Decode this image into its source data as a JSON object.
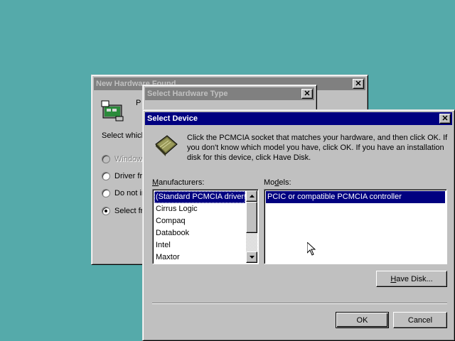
{
  "windows": {
    "new_hardware": {
      "title": "New Hardware Found",
      "device_text_partial": "P",
      "prompt_partial": "Select which",
      "options": [
        {
          "label": "Window",
          "selected": false,
          "disabled": true
        },
        {
          "label": "Driver fro",
          "selected": false,
          "disabled": false
        },
        {
          "label": "Do not in",
          "selected": false,
          "disabled": false
        },
        {
          "label": "Select fro",
          "selected": true,
          "disabled": false
        }
      ],
      "close_symbol": "✕"
    },
    "select_hardware_type": {
      "title": "Select Hardware Type",
      "close_symbol": "✕"
    },
    "select_device": {
      "title": "Select Device",
      "close_symbol": "✕",
      "instructions": "Click the PCMCIA socket that matches your hardware, and then click OK. If you don't know which model you have, click OK. If you have an installation disk for this device, click Have Disk.",
      "manufacturers_label": "Manufacturers:",
      "manufacturers_label_ul": "M",
      "manufacturers_label_rest": "anufacturers:",
      "models_label_pre": "Mo",
      "models_label_ul": "d",
      "models_label_rest": "els:",
      "manufacturers": [
        "(Standard PCMCIA drivers)",
        "Cirrus Logic",
        "Compaq",
        "Databook",
        "Intel",
        "Maxtor"
      ],
      "selected_manufacturer_index": 0,
      "models": [
        "PCIC or compatible PCMCIA controller"
      ],
      "selected_model_index": 0,
      "have_disk_ul": "H",
      "have_disk_rest": "ave Disk...",
      "ok_label": "OK",
      "cancel_label": "Cancel"
    }
  },
  "colors": {
    "desktop": "#55aaaa",
    "active_title": "#000080",
    "inactive_title": "#808080",
    "face": "#c0c0c0"
  }
}
